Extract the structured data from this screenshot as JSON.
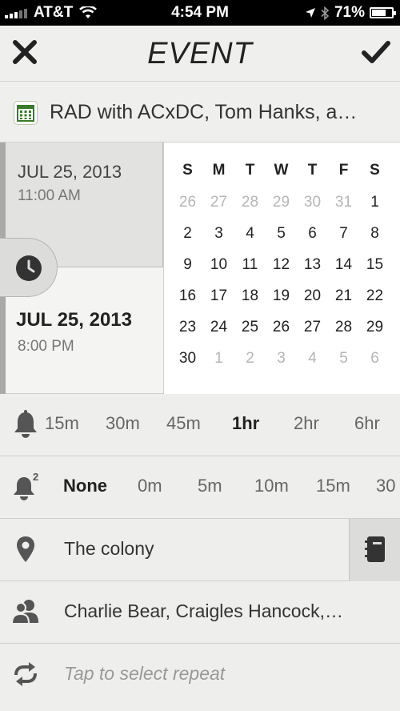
{
  "status_bar": {
    "carrier": "AT&T",
    "time": "4:54 PM",
    "battery": "71%",
    "battery_level": 0.71
  },
  "nav": {
    "title": "EVENT"
  },
  "event": {
    "name": "RAD with ACxDC, Tom Hanks, a…"
  },
  "start": {
    "date": "JUL 25, 2013",
    "time": "11:00 AM"
  },
  "end": {
    "date": "JUL 25, 2013",
    "time": "8:00 PM"
  },
  "calendar": {
    "weekdays": [
      "S",
      "M",
      "T",
      "W",
      "T",
      "F",
      "S"
    ],
    "weeks": [
      [
        "26",
        "27",
        "28",
        "29",
        "30",
        "31",
        "1"
      ],
      [
        "2",
        "3",
        "4",
        "5",
        "6",
        "7",
        "8"
      ],
      [
        "9",
        "10",
        "11",
        "12",
        "13",
        "14",
        "15"
      ],
      [
        "16",
        "17",
        "18",
        "19",
        "20",
        "21",
        "22"
      ],
      [
        "23",
        "24",
        "25",
        "26",
        "27",
        "28",
        "29"
      ],
      [
        "30",
        "1",
        "2",
        "3",
        "4",
        "5",
        "6"
      ]
    ]
  },
  "alert": {
    "options": [
      "15m",
      "30m",
      "45m",
      "1hr",
      "2hr",
      "6hr"
    ],
    "selected": "1hr"
  },
  "second_alert": {
    "badge": "2",
    "options": [
      "None",
      "0m",
      "5m",
      "10m",
      "15m",
      "30"
    ],
    "selected": "None"
  },
  "location": {
    "value": "The colony"
  },
  "invitees": {
    "value": "Charlie Bear, Craigles Hancock,…"
  },
  "repeat": {
    "placeholder": "Tap to select repeat"
  },
  "colors": {
    "accent_green": "#3b7a2a",
    "icon_gray": "#555555",
    "muted_day": "#b5b5b5"
  }
}
